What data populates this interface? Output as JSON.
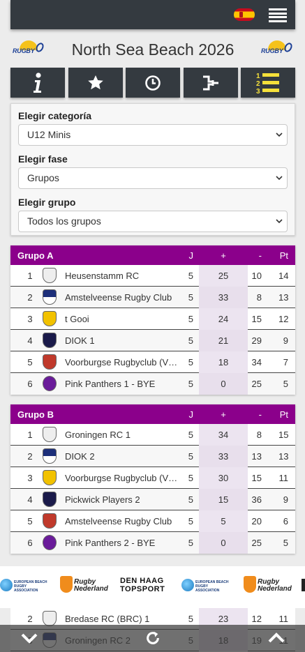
{
  "header": {
    "title": "North Sea Beach 2026",
    "logo_text": "RUGBY"
  },
  "nav": [
    "info-icon",
    "star-icon",
    "clock-icon",
    "bracket-icon",
    "standings-icon"
  ],
  "filters": {
    "category_label": "Elegir categoría",
    "category_value": "U12 Minis",
    "phase_label": "Elegir fase",
    "phase_value": "Grupos",
    "group_label": "Elegir grupo",
    "group_value": "Todos los grupos"
  },
  "columns": {
    "played": "J",
    "for": "+",
    "against": "-",
    "points": "Pt"
  },
  "groups": [
    {
      "name": "Grupo A",
      "rows": [
        {
          "pos": "1",
          "team": "Heusenstamm RC",
          "j": "5",
          "plus": "25",
          "minus": "10",
          "pt": "14"
        },
        {
          "pos": "2",
          "team": "Amstelveense Rugby Club",
          "j": "5",
          "plus": "33",
          "minus": "8",
          "pt": "13"
        },
        {
          "pos": "3",
          "team": "t Gooi",
          "j": "5",
          "plus": "24",
          "minus": "15",
          "pt": "12"
        },
        {
          "pos": "4",
          "team": "DIOK 1",
          "j": "5",
          "plus": "21",
          "minus": "29",
          "pt": "9"
        },
        {
          "pos": "5",
          "team": "Voorburgse Rugbyclub (VRC)",
          "j": "5",
          "plus": "18",
          "minus": "34",
          "pt": "7"
        },
        {
          "pos": "6",
          "team": "Pink Panthers 1 - BYE",
          "j": "5",
          "plus": "0",
          "minus": "25",
          "pt": "5"
        }
      ]
    },
    {
      "name": "Grupo B",
      "rows": [
        {
          "pos": "1",
          "team": "Groningen RC 1",
          "j": "5",
          "plus": "34",
          "minus": "8",
          "pt": "15"
        },
        {
          "pos": "2",
          "team": "DIOK 2",
          "j": "5",
          "plus": "33",
          "minus": "13",
          "pt": "13"
        },
        {
          "pos": "3",
          "team": "Voorburgse Rugbyclub (VRC)",
          "j": "5",
          "plus": "30",
          "minus": "15",
          "pt": "11"
        },
        {
          "pos": "4",
          "team": "Pickwick Players 2",
          "j": "5",
          "plus": "15",
          "minus": "36",
          "pt": "9"
        },
        {
          "pos": "5",
          "team": "Amstelveense Rugby Club",
          "j": "5",
          "plus": "5",
          "minus": "20",
          "pt": "6"
        },
        {
          "pos": "6",
          "team": "Pink Panthers 2 - BYE",
          "j": "5",
          "plus": "0",
          "minus": "25",
          "pt": "5"
        }
      ]
    }
  ],
  "peek_rows": [
    {
      "pos": "2",
      "team": "Bredase RC (BRC) 1",
      "j": "5",
      "plus": "23",
      "minus": "12",
      "pt": "11"
    },
    {
      "pos": "3",
      "team": "Groningen RC 2",
      "j": "5",
      "plus": "18",
      "minus": "19",
      "pt": "11"
    }
  ],
  "sponsors": {
    "erb": "EUROPEAN BEACH RUGBY ASSOCIATION",
    "rn": "Rugby Nederland",
    "dh_line1": "DEN HAAG",
    "dh_line2": "TOPSPORT"
  },
  "colors": {
    "group_header": "#8b008b",
    "dark": "#343a40",
    "standings_icon": "#f5e03a"
  }
}
